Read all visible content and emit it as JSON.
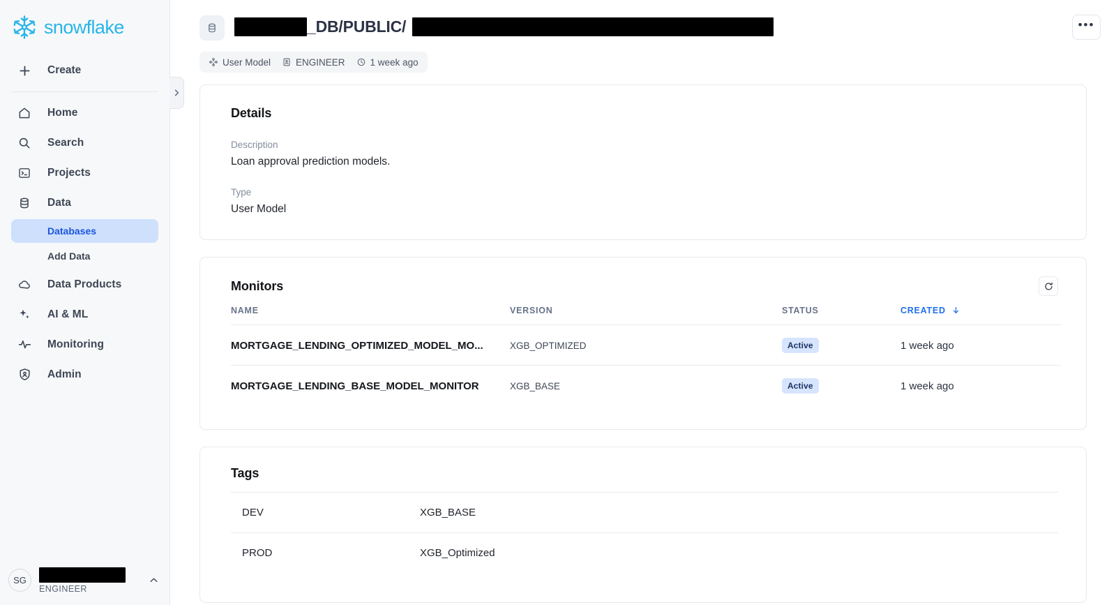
{
  "brand": {
    "name": "snowflake",
    "logo_icon": "snowflake-logo-icon",
    "accent": "#29b5e8"
  },
  "sidebar": {
    "create": {
      "label": "Create",
      "icon": "plus-icon"
    },
    "items": [
      {
        "label": "Home",
        "icon": "home-icon"
      },
      {
        "label": "Search",
        "icon": "search-icon"
      },
      {
        "label": "Projects",
        "icon": "terminal-icon"
      },
      {
        "label": "Data",
        "icon": "database-icon"
      },
      {
        "label": "Data Products",
        "icon": "cloud-icon"
      },
      {
        "label": "AI & ML",
        "icon": "sparkles-icon"
      },
      {
        "label": "Monitoring",
        "icon": "activity-pulse-icon"
      },
      {
        "label": "Admin",
        "icon": "shield-person-icon"
      }
    ],
    "data_subitems": [
      {
        "label": "Databases",
        "active": true
      },
      {
        "label": "Add Data",
        "active": false
      }
    ],
    "collapse_handle_icon": "chevron-right-icon",
    "user": {
      "initials": "SG",
      "name_redacted": true,
      "role": "ENGINEER",
      "caret_icon": "chevron-up-icon"
    },
    "active_color": "#1a56db",
    "active_bg": "#cfe0fd"
  },
  "header": {
    "db_icon": "database-icon",
    "breadcrumb": {
      "segment_1_redacted": true,
      "segment_1_suffix": "_DB",
      "separator_1": " / ",
      "segment_2": "PUBLIC",
      "separator_2": " / ",
      "segment_3_redacted": true
    },
    "more_button": {
      "label": "•••",
      "icon": "ellipsis-icon"
    },
    "meta_chips": [
      {
        "icon": "model-node-icon",
        "label": "User Model"
      },
      {
        "icon": "id-badge-icon",
        "label": "ENGINEER"
      },
      {
        "icon": "clock-icon",
        "label": "1 week ago"
      }
    ]
  },
  "details": {
    "title": "Details",
    "description_label": "Description",
    "description_value": "Loan approval prediction models.",
    "type_label": "Type",
    "type_value": "User Model"
  },
  "monitors": {
    "title": "Monitors",
    "refresh_icon": "refresh-icon",
    "columns": [
      {
        "label": "NAME",
        "sorted": false
      },
      {
        "label": "VERSION",
        "sorted": false
      },
      {
        "label": "STATUS",
        "sorted": false
      },
      {
        "label": "CREATED",
        "sorted": true,
        "sort_icon": "arrow-down-icon"
      }
    ],
    "rows": [
      {
        "name": "MORTGAGE_LENDING_OPTIMIZED_MODEL_MO...",
        "version": "XGB_OPTIMIZED",
        "status": "Active",
        "created": "1 week ago"
      },
      {
        "name": "MORTGAGE_LENDING_BASE_MODEL_MONITOR",
        "version": "XGB_BASE",
        "status": "Active",
        "created": "1 week ago"
      }
    ],
    "badge_bg": "#d6e4fd",
    "badge_color": "#18325e"
  },
  "tags": {
    "title": "Tags",
    "rows": [
      {
        "key": "DEV",
        "value": "XGB_BASE"
      },
      {
        "key": "PROD",
        "value": "XGB_Optimized"
      }
    ]
  }
}
